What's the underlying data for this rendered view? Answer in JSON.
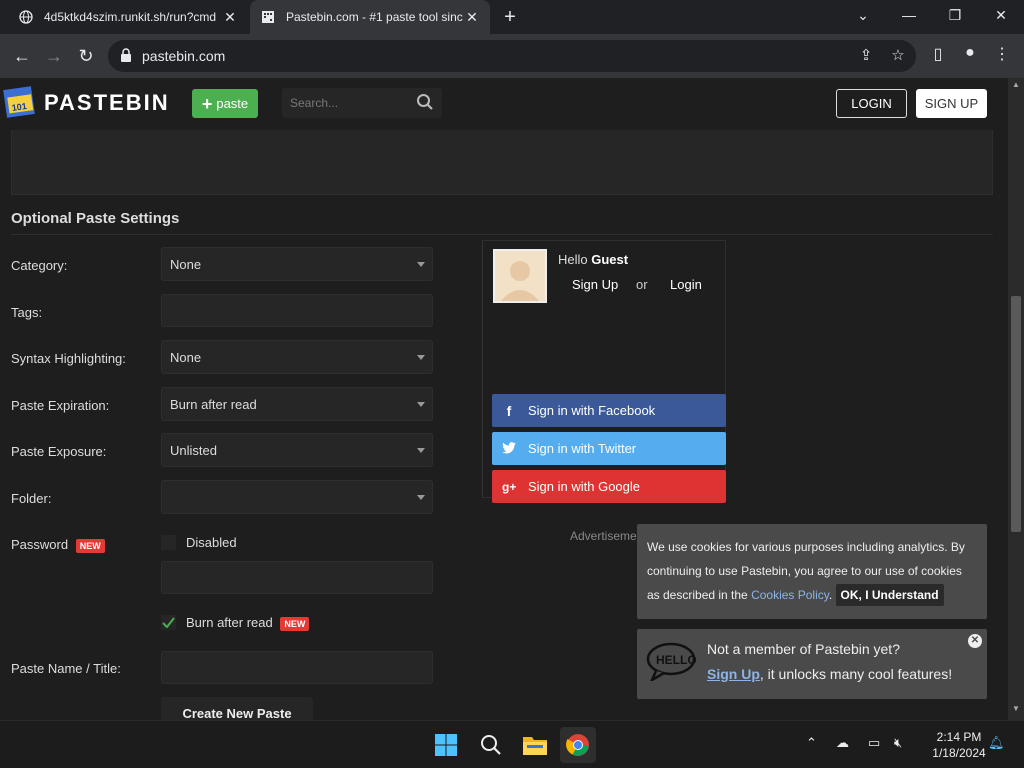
{
  "browser": {
    "tabs": [
      {
        "title": "4d5ktkd4szim.runkit.sh/run?cmd",
        "active": false
      },
      {
        "title": "Pastebin.com - #1 paste tool sinc",
        "active": true
      }
    ],
    "url": "pastebin.com"
  },
  "header": {
    "logo_text": "PASTEBIN",
    "paste_button": "paste",
    "search_placeholder": "Search...",
    "login": "LOGIN",
    "signup": "SIGN UP"
  },
  "settings": {
    "title": "Optional Paste Settings",
    "category": {
      "label": "Category:",
      "value": "None"
    },
    "tags": {
      "label": "Tags:"
    },
    "syntax": {
      "label": "Syntax Highlighting:",
      "value": "None"
    },
    "expiration": {
      "label": "Paste Expiration:",
      "value": "Burn after read"
    },
    "exposure": {
      "label": "Paste Exposure:",
      "value": "Unlisted"
    },
    "folder": {
      "label": "Folder:",
      "value": ""
    },
    "password": {
      "label": "Password",
      "badge": "NEW",
      "toggle_label": "Disabled"
    },
    "burn": {
      "label": "Burn after read",
      "badge": "NEW",
      "checked": true
    },
    "name": {
      "label": "Paste Name / Title:"
    },
    "create_button": "Create New Paste"
  },
  "guest": {
    "hello": "Hello",
    "name": "Guest",
    "signup": "Sign Up",
    "or": "or",
    "login": "Login",
    "facebook": "Sign in with Facebook",
    "twitter": "Sign in with Twitter",
    "google": "Sign in with Google",
    "advertisement": "Advertisement"
  },
  "cookie": {
    "text1": "We use cookies for various purposes including analytics. By continuing to use Pastebin, you agree to our use of cookies as described in the ",
    "link": "Cookies Policy",
    "text2": ". ",
    "ok": "OK, I Understand"
  },
  "member": {
    "line1": "Not a member of Pastebin yet?",
    "signup": "Sign Up",
    "line2": ", it unlocks many cool features!"
  },
  "taskbar": {
    "time": "2:14 PM",
    "date": "1/18/2024"
  },
  "colors": {
    "paste_green": "#4caf50",
    "facebook": "#3b5998",
    "twitter": "#55acee",
    "google": "#dd3333",
    "badge_red": "#e53935"
  }
}
